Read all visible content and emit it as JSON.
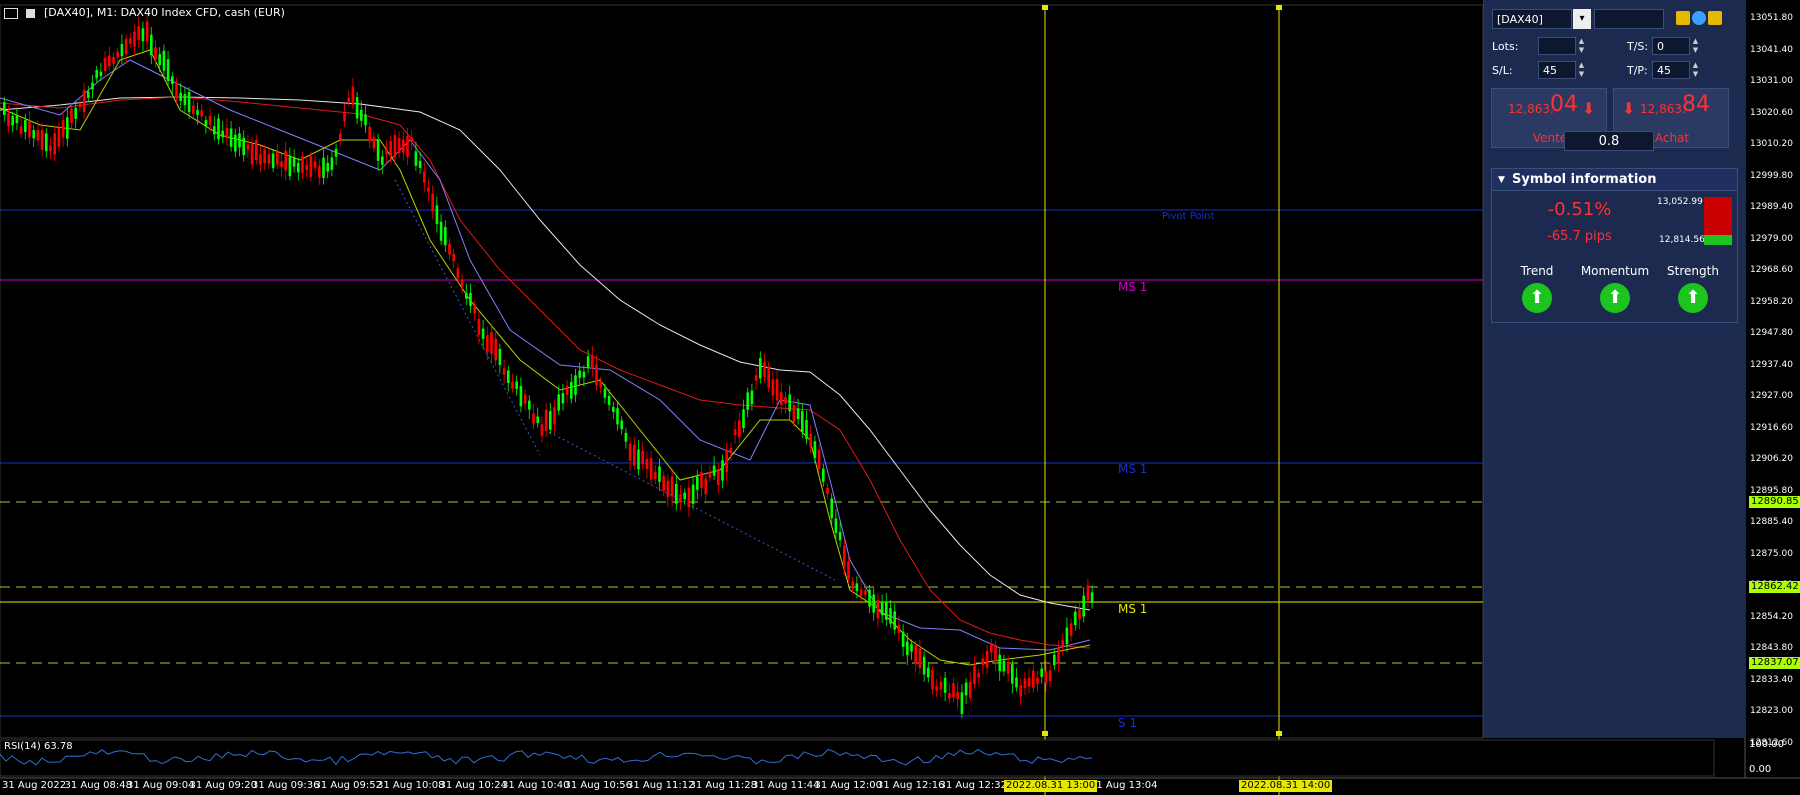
{
  "chart_title": "[DAX40], M1:  DAX40 Index CFD, cash (EUR)",
  "trade_panel": {
    "symbol": "[DAX40]",
    "lots_label": "Lots:",
    "lots_value": "",
    "ts_label": "T/S:",
    "ts_value": "0",
    "sl_label": "S/L:",
    "sl_value": "45",
    "tp_label": "T/P:",
    "tp_value": "45",
    "sell_small": "12,863.",
    "sell_big": "04",
    "sell_label": "Vente",
    "buy_small": "12,863.",
    "buy_big": "84",
    "buy_label": "Achat",
    "spread": "0.8"
  },
  "symbol_info": {
    "header": "Symbol information",
    "percent": "-0.51%",
    "pips": "-65.7 pips",
    "high": "13,052.99",
    "low": "12,814.56",
    "trend": "Trend",
    "momentum": "Momentum",
    "strength": "Strength"
  },
  "level_labels": {
    "pivot": "Pivot Point",
    "ms1_magenta": "MS 1",
    "ms1_blue": "MS 1",
    "ms1_yellow": "MS 1",
    "s1": "S 1"
  },
  "price_axis": [
    "13051.80",
    "13041.40",
    "13031.00",
    "13020.60",
    "13010.20",
    "12999.80",
    "12989.40",
    "12979.00",
    "12968.60",
    "12958.20",
    "12947.80",
    "12937.40",
    "12927.00",
    "12916.60",
    "12906.20",
    "12895.80",
    "12885.40",
    "12875.00",
    "12864.60",
    "12854.20",
    "12843.80",
    "12833.40",
    "12823.00",
    "12812.60"
  ],
  "price_tags": {
    "upper": "12890.85",
    "current": "12862.42",
    "lower": "12837.07"
  },
  "rsi": {
    "label": "RSI(14) 63.78",
    "axis_top": "100.00",
    "axis_bottom": "0.00"
  },
  "time_axis": [
    "31 Aug 2022",
    "31 Aug 08:48",
    "31 Aug 09:04",
    "31 Aug 09:20",
    "31 Aug 09:36",
    "31 Aug 09:52",
    "31 Aug 10:08",
    "31 Aug 10:24",
    "31 Aug 10:40",
    "31 Aug 10:56",
    "31 Aug 11:12",
    "31 Aug 11:28",
    "31 Aug 11:44",
    "31 Aug 12:00",
    "31 Aug 12:16",
    "31 Aug 12:32",
    "31 Aug 13:04"
  ],
  "time_tags": {
    "vline1": "2022.08.31 13:00",
    "vline2": "2022.08.31 14:00"
  },
  "colors": {
    "bull": "#00ff00",
    "bear": "#ff0000",
    "panel": "#1b2a4e",
    "accent_red": "#ff3030",
    "accent_green": "#1ec41e"
  }
}
